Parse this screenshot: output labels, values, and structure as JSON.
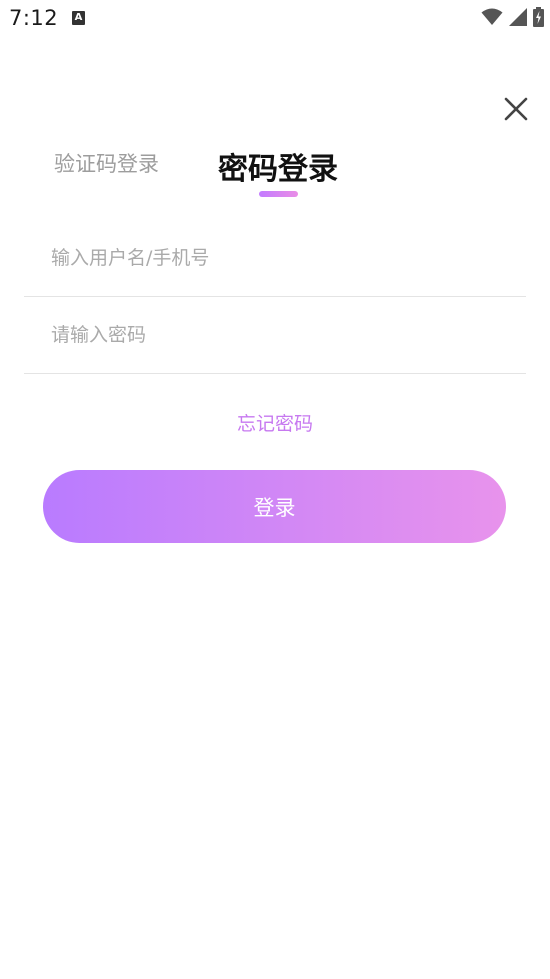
{
  "status_bar": {
    "time": "7:12",
    "notification_icon": "text-a-icon",
    "icons": [
      "wifi-icon",
      "signal-icon",
      "battery-charging-icon"
    ]
  },
  "close_icon": "close-icon",
  "tabs": {
    "inactive_label": "验证码登录",
    "active_label": "密码登录"
  },
  "form": {
    "username_placeholder": "输入用户名/手机号",
    "username_value": "",
    "password_placeholder": "请输入密码",
    "password_value": ""
  },
  "forgot_label": "忘记密码",
  "login_label": "登录",
  "colors": {
    "accent_start": "#b97bff",
    "accent_end": "#e893ec",
    "link": "#c779f0"
  }
}
